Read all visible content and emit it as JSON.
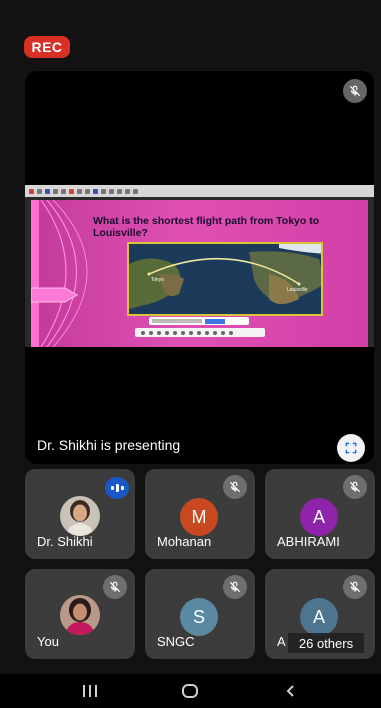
{
  "recording": {
    "label": "REC"
  },
  "presentation": {
    "presenter_text": "Dr. Shikhi is presenting",
    "slide": {
      "title": "What is the shortest flight path from Tokyo to Louisville?",
      "map_labels": [
        "Tokyo",
        "Louisville"
      ]
    }
  },
  "participants": [
    {
      "name": "Dr. Shikhi",
      "avatar": "photo",
      "status": "speaking"
    },
    {
      "name": "Mohanan",
      "initial": "M",
      "color": "#c8491f",
      "status": "muted"
    },
    {
      "name": "ABHIRAMI",
      "initial": "A",
      "color": "#8e24aa",
      "status": "muted"
    },
    {
      "name": "You",
      "avatar": "photo",
      "status": "muted"
    },
    {
      "name": "SNGC",
      "initial": "S",
      "color": "#5a8aa3",
      "status": "muted"
    },
    {
      "name": "A",
      "initial": "A",
      "color": "#4e7590",
      "status": "muted",
      "overlay": "26 others"
    }
  ],
  "icons": {
    "muted": "mic-off-icon",
    "speaking": "audio-level-icon",
    "fullscreen": "fullscreen-icon"
  },
  "navbar": {
    "recent": "recent-apps-icon",
    "home": "home-icon",
    "back": "back-icon"
  }
}
